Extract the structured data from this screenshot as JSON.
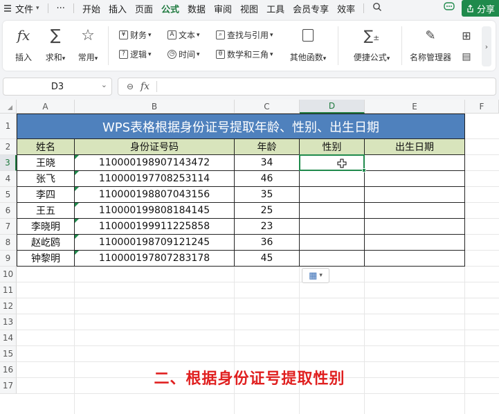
{
  "menubar": {
    "file_label": "文件",
    "more_label": "···",
    "items": [
      "开始",
      "插入",
      "页面",
      "公式",
      "数据",
      "审阅",
      "视图",
      "工具",
      "会员专享",
      "效率"
    ],
    "active_index": 3,
    "share_label": "分享"
  },
  "ribbon": {
    "insert_fn_label": "插入",
    "sum_label": "求和",
    "common_label": "常用",
    "finance_label": "财务",
    "text_label": "文本",
    "lookup_label": "查找与引用",
    "logic_label": "逻辑",
    "time_label": "时间",
    "math_label": "数学和三角",
    "other_fn_label": "其他函数",
    "quick_formula_label": "便捷公式",
    "name_manager_label": "名称管理器"
  },
  "formula_bar": {
    "name_box": "D3",
    "fx_label": "fx",
    "formula": ""
  },
  "sheet": {
    "columns": [
      "A",
      "B",
      "C",
      "D",
      "E",
      "F"
    ],
    "rows": [
      "1",
      "2",
      "3",
      "4",
      "5",
      "6",
      "7",
      "8",
      "9",
      "10",
      "11",
      "12",
      "13",
      "14",
      "15",
      "16",
      "17"
    ],
    "selected_column": "D",
    "selected_row": "3",
    "title": "WPS表格根据身份证号提取年龄、性别、出生日期",
    "headers": [
      "姓名",
      "身份证号码",
      "年龄",
      "性别",
      "出生日期"
    ],
    "data": [
      [
        "王晓",
        "110000198907143472",
        "34",
        "",
        ""
      ],
      [
        "张飞",
        "110000197708253114",
        "46",
        "",
        ""
      ],
      [
        "李四",
        "110000198807043156",
        "35",
        "",
        ""
      ],
      [
        "王五",
        "110000199808184145",
        "25",
        "",
        ""
      ],
      [
        "李晓明",
        "110000199911225858",
        "23",
        "",
        ""
      ],
      [
        "赵屹鸥",
        "110000198709121245",
        "36",
        "",
        ""
      ],
      [
        "钟黎明",
        "110000197807283178",
        "45",
        "",
        ""
      ]
    ]
  },
  "caption": "二、根据身份证号提取性别",
  "colors": {
    "accent": "#1f7a3f",
    "title_fill": "#4f81bd",
    "header_fill": "#d8e4bc",
    "caption": "#e02020"
  }
}
